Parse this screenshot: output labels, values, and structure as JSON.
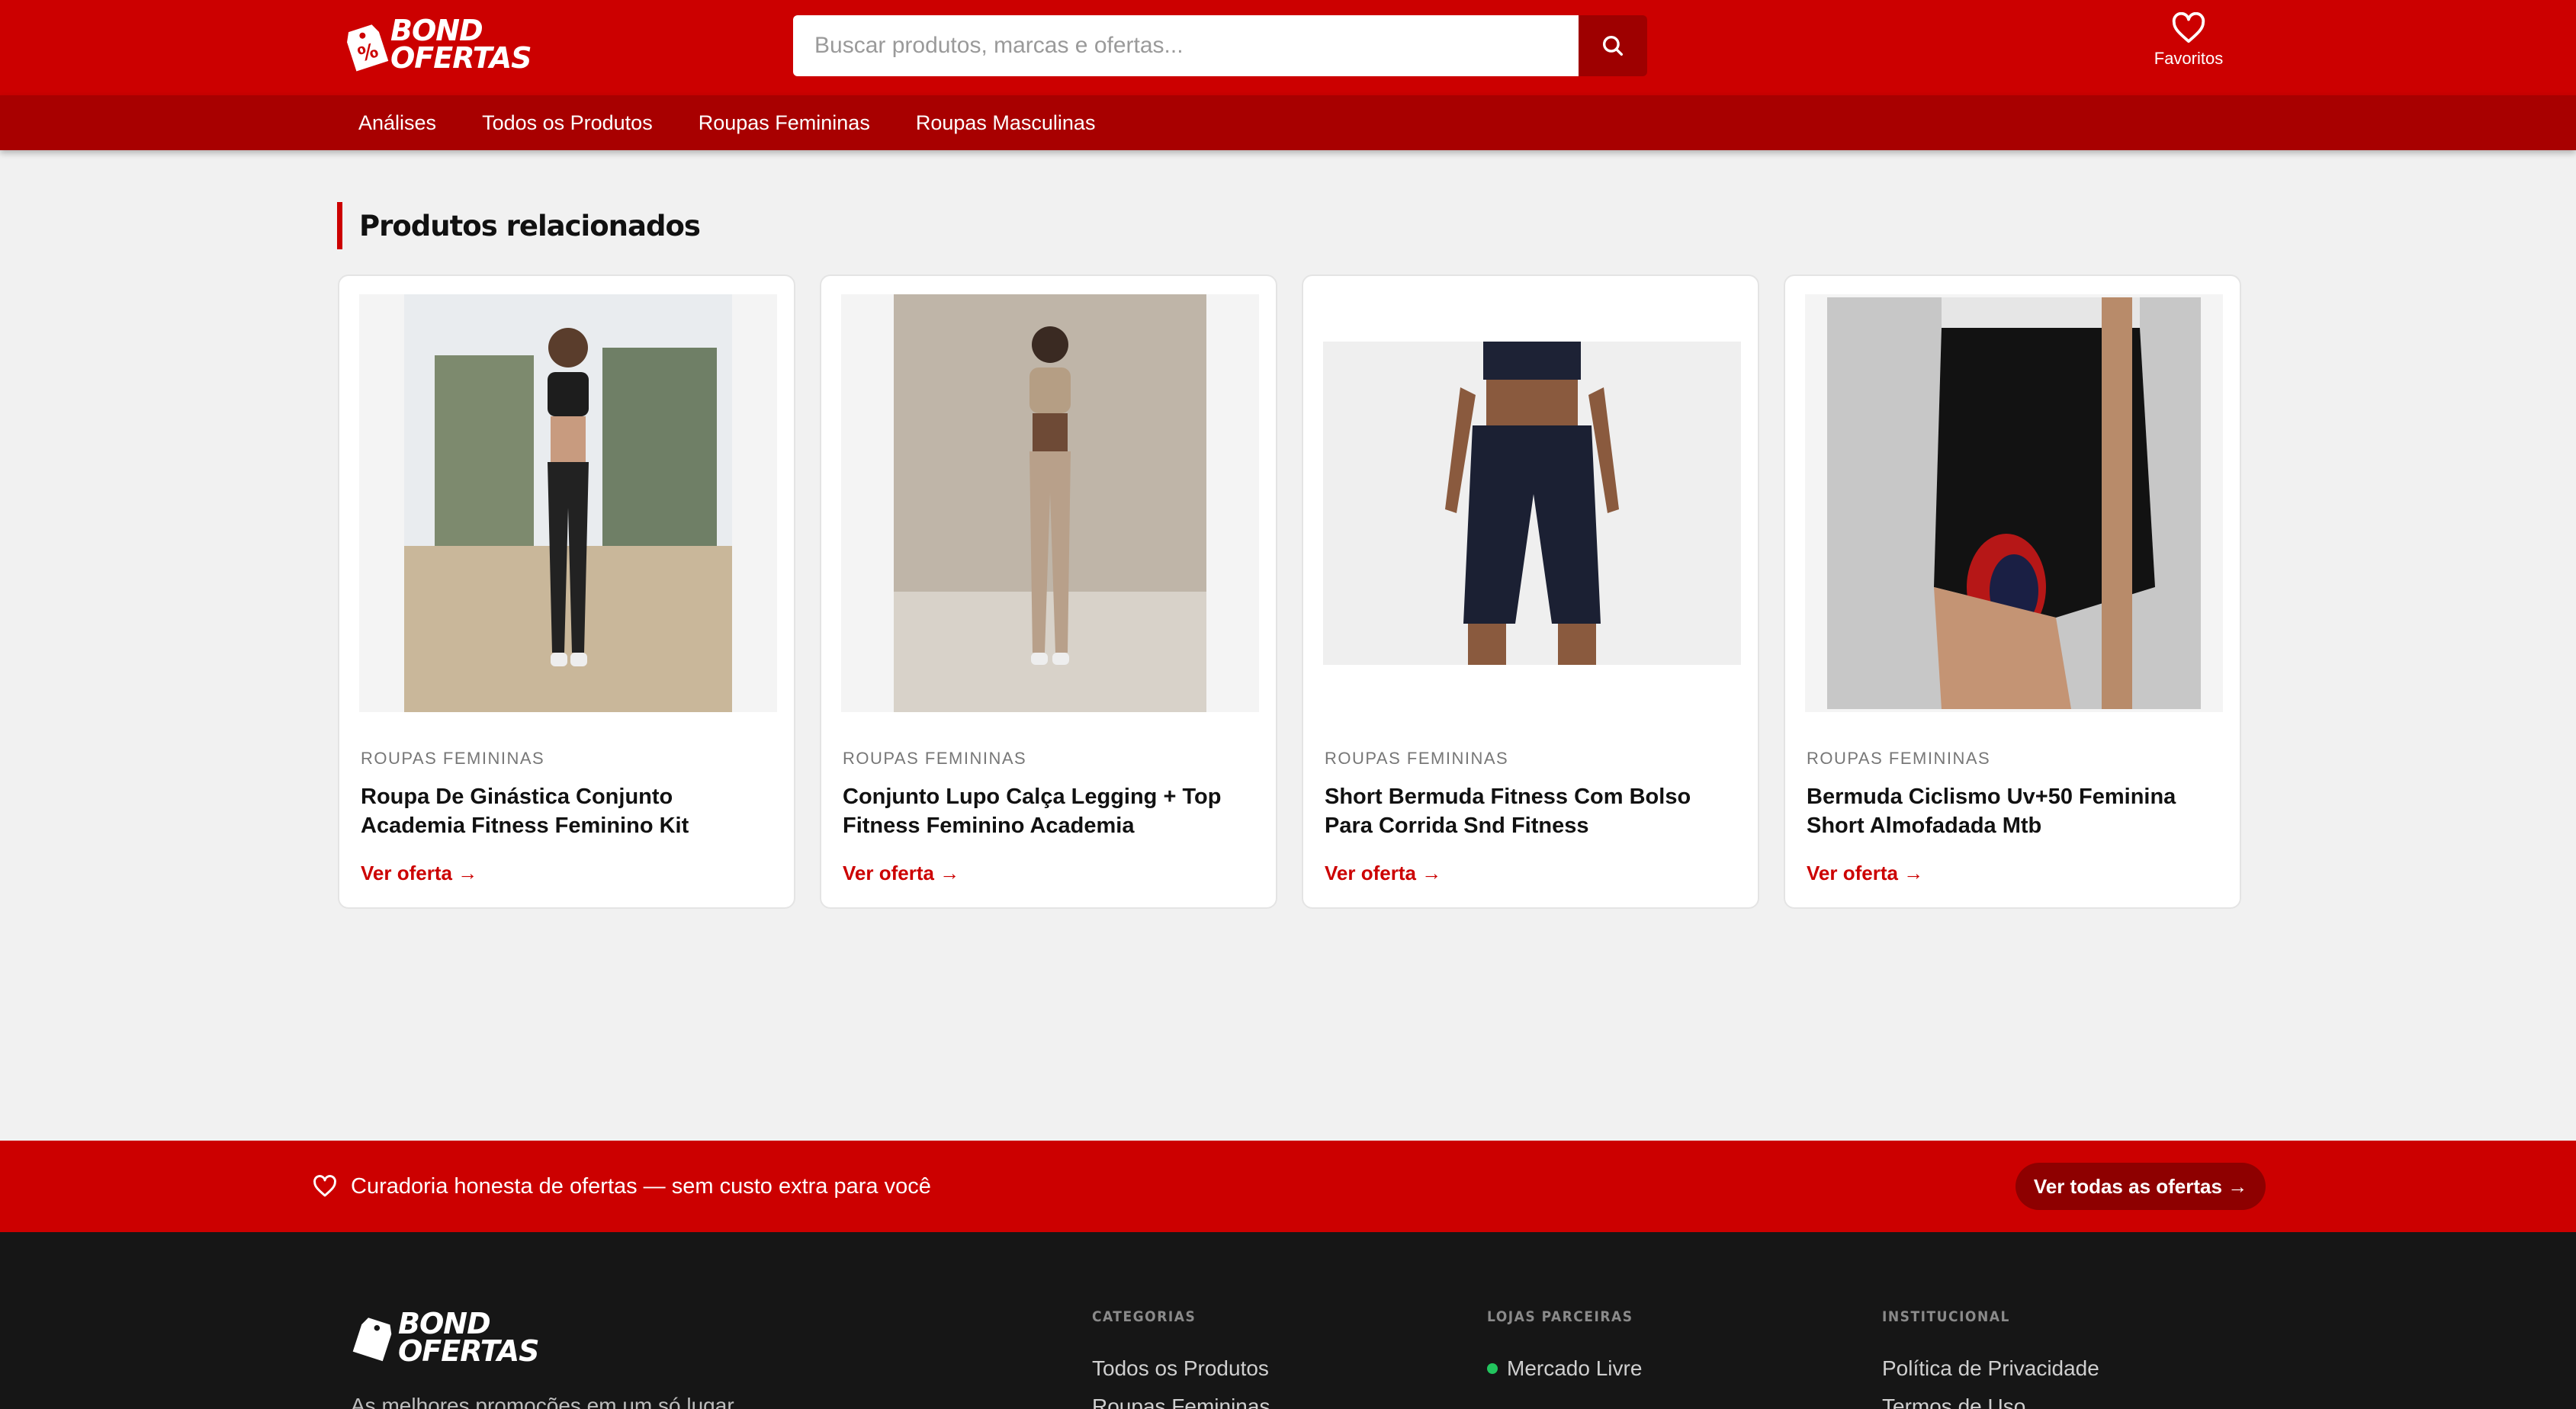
{
  "brand": {
    "name_line1": "BOND",
    "name_line2": "OFERTAS",
    "badge": "%"
  },
  "header": {
    "search_placeholder": "Buscar produtos, marcas e ofertas...",
    "favorites_label": "Favoritos"
  },
  "nav": {
    "items": [
      "Análises",
      "Todos os Produtos",
      "Roupas Femininas",
      "Roupas Masculinas"
    ]
  },
  "related": {
    "title": "Produtos relacionados",
    "products": [
      {
        "category": "ROUPAS FEMININAS",
        "title": "Roupa De Ginástica Conjunto Academia Fitness Feminino Kit",
        "cta": "Ver oferta →"
      },
      {
        "category": "ROUPAS FEMININAS",
        "title": "Conjunto Lupo Calça Legging + Top Fitness Feminino Academia",
        "cta": "Ver oferta →"
      },
      {
        "category": "ROUPAS FEMININAS",
        "title": "Short Bermuda Fitness Com Bolso Para Corrida Snd Fitness",
        "cta": "Ver oferta →"
      },
      {
        "category": "ROUPAS FEMININAS",
        "title": "Bermuda Ciclismo Uv+50 Feminina Short Almofadada Mtb",
        "cta": "Ver oferta →"
      }
    ]
  },
  "promo": {
    "text": "Curadoria honesta de ofertas — sem custo extra para você",
    "button": "Ver todas as ofertas →"
  },
  "footer": {
    "tagline": "As melhores promoções em um só lugar",
    "columns": [
      {
        "title": "CATEGORIAS",
        "items": [
          "Todos os Produtos",
          "Roupas Femininas"
        ]
      },
      {
        "title": "LOJAS PARCEIRAS",
        "items": [
          "Mercado Livre"
        ]
      },
      {
        "title": "INSTITUCIONAL",
        "items": [
          "Política de Privacidade",
          "Termos de Uso"
        ]
      }
    ]
  },
  "colors": {
    "brand_red": "#cc0000",
    "nav_red": "#a80000",
    "footer_bg": "#161616",
    "status_green": "#22c55e"
  },
  "icons": [
    "price-tag-icon",
    "search-icon",
    "heart-icon",
    "arrow-right-icon",
    "green-dot-icon"
  ]
}
